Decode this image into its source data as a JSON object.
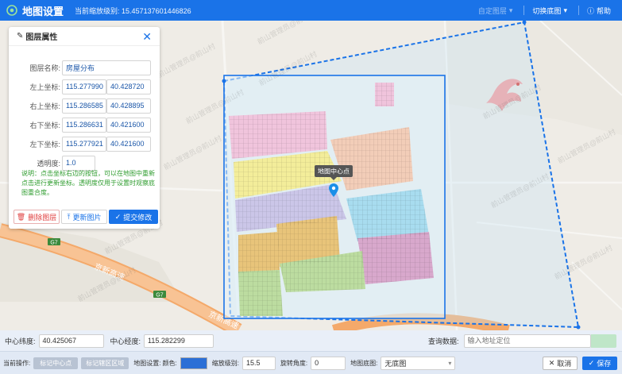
{
  "header": {
    "title": "地图设置",
    "zoom_label": "当前缩放级别:",
    "zoom_value": "15.457137601446826",
    "custom_label": "自定图层",
    "switch_label": "切换底图",
    "help_label": "帮助"
  },
  "map": {
    "tooltip": "地图中心点",
    "road_label": "京新高速",
    "road_label_2": "京新高速",
    "road_code": "G7",
    "road_code_2": "G7",
    "watermark": "前山管理员@前山村",
    "colors": {
      "pink": "#f0c4dc",
      "peach": "#f2cdb8",
      "yellow": "#f3ed9a",
      "lavender": "#cbc6e8",
      "teal": "#a8dcef",
      "orange": "#e8c47a",
      "green": "#bcdca0",
      "magenta": "#d8a8cc",
      "highway": "#f4a96a",
      "selection": "#1a73e8"
    }
  },
  "panel": {
    "title": "图层属性",
    "name_label": "图层名称:",
    "name_value": "房屋分布",
    "tl_label": "左上坐标:",
    "tl_lng": "115.277990",
    "tl_lat": "40.428720",
    "tr_label": "右上坐标:",
    "tr_lng": "115.286585",
    "tr_lat": "40.428895",
    "br_label": "右下坐标:",
    "br_lng": "115.286631",
    "br_lat": "40.421600",
    "bl_label": "左下坐标:",
    "bl_lng": "115.277921",
    "bl_lat": "40.421600",
    "opacity_label": "透明度:",
    "opacity_value": "1.0",
    "note": "说明：点击坐标右边的按钮，可以在地图中重新点击进行更新坐标。透明度仅用于设置时观察底图重合度。",
    "delete_label": "删除图层",
    "update_label": "更新图片",
    "submit_label": "提交修改"
  },
  "bar1": {
    "lat_label": "中心纬度:",
    "lat_value": "40.425067",
    "lng_label": "中心经度:",
    "lng_value": "115.282299",
    "query_label": "查询数据:",
    "query_placeholder": "输入地址定位"
  },
  "bar2": {
    "op_label": "当前操作:",
    "mark_center": "标记中心点",
    "mark_area": "标记辖区区域",
    "map_setting_label": "地图设置:",
    "color_label": "颜色:",
    "color_value": "#2b6fd6",
    "zoom_label": "缩放级别:",
    "zoom_value": "15.5",
    "rotate_label": "旋转角度:",
    "rotate_value": "0",
    "base_label": "地图底图:",
    "base_value": "无底图",
    "cancel_label": "取消",
    "save_label": "保存"
  }
}
